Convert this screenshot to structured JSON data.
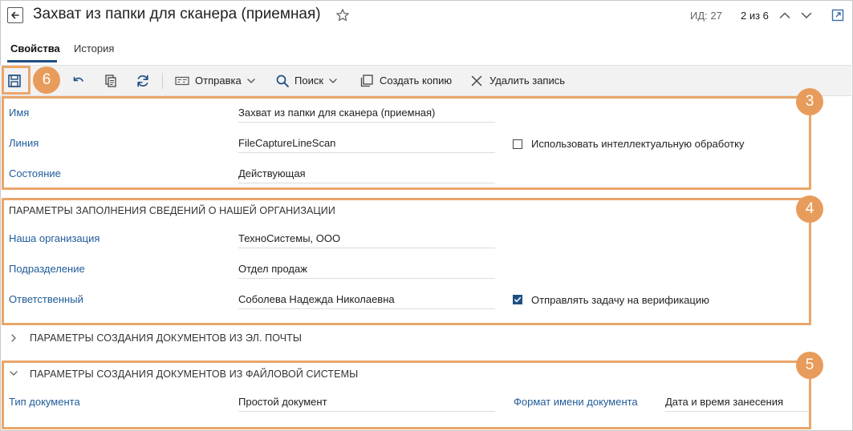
{
  "header": {
    "title": "Захват из папки для сканера (приемная)",
    "id_label": "ИД: 27",
    "position": "2 из 6"
  },
  "tabs": [
    {
      "label": "Свойства",
      "active": true
    },
    {
      "label": "История",
      "active": false
    }
  ],
  "toolbar": {
    "badge": "6",
    "send_label": "Отправка",
    "search_label": "Поиск",
    "copy_label": "Создать копию",
    "delete_label": "Удалить запись"
  },
  "section_main": {
    "badge": "3",
    "name_label": "Имя",
    "name_value": "Захват из папки для сканера (приемная)",
    "line_label": "Линия",
    "line_value": "FileCaptureLineScan",
    "state_label": "Состояние",
    "state_value": "Действующая",
    "smart_checkbox_label": "Использовать интеллектуальную обработку",
    "smart_checked": false
  },
  "section_org": {
    "badge": "4",
    "title": "ПАРАМЕТРЫ ЗАПОЛНЕНИЯ СВЕДЕНИЙ О НАШЕЙ ОРГАНИЗАЦИИ",
    "org_label": "Наша организация",
    "org_value": "ТехноСистемы, ООО",
    "dept_label": "Подразделение",
    "dept_value": "Отдел продаж",
    "resp_label": "Ответственный",
    "resp_value": "Соболева Надежда Николаевна",
    "verify_checkbox_label": "Отправлять задачу на верификацию",
    "verify_checked": true
  },
  "section_email": {
    "title": "ПАРАМЕТРЫ СОЗДАНИЯ ДОКУМЕНТОВ ИЗ ЭЛ. ПОЧТЫ",
    "expanded": false
  },
  "section_fs": {
    "badge": "5",
    "title": "ПАРАМЕТРЫ СОЗДАНИЯ ДОКУМЕНТОВ ИЗ ФАЙЛОВОЙ СИСТЕМЫ",
    "expanded": true,
    "doctype_label": "Тип документа",
    "doctype_value": "Простой документ",
    "format_label": "Формат имени документа",
    "format_value": "Дата и время занесения"
  },
  "colors": {
    "highlight": "#e9a66a",
    "badge": "#e89c5b",
    "label_blue": "#1f5b99",
    "checkbox_on": "#1f4f84"
  },
  "icons": [
    "back-arrow-icon",
    "star-icon",
    "chevron-up-icon",
    "chevron-down-icon",
    "open-external-icon",
    "save-icon",
    "undo-icon",
    "copy-icon",
    "refresh-icon",
    "send-icon",
    "search-icon",
    "create-copy-icon",
    "close-icon",
    "expand-chevron-icon"
  ]
}
